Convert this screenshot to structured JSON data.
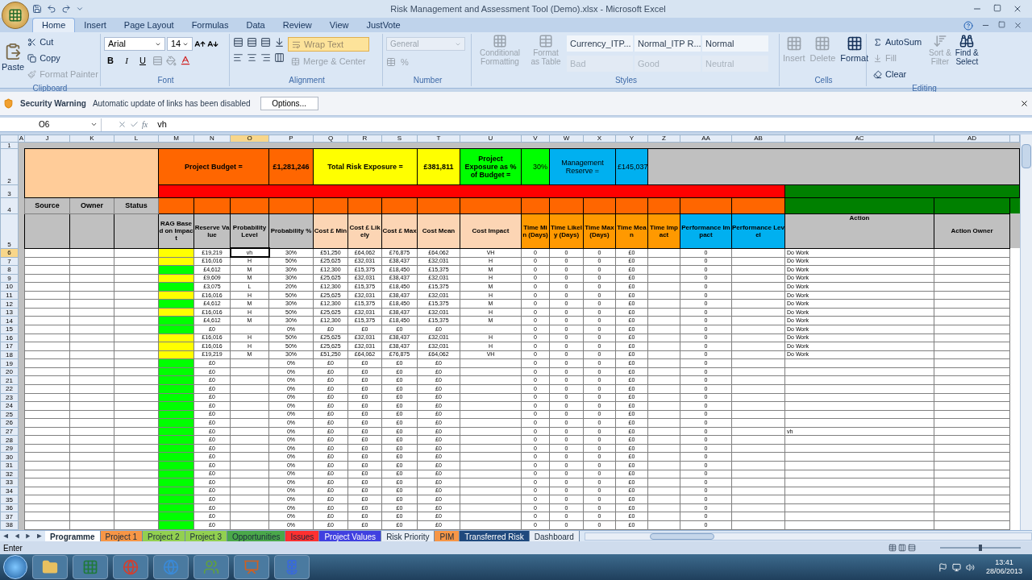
{
  "window": {
    "title": "Risk Management and Assessment Tool (Demo).xlsx - Microsoft Excel"
  },
  "ribbon_tabs": [
    {
      "label": "Home",
      "selected": true
    },
    {
      "label": "Insert",
      "selected": false
    },
    {
      "label": "Page Layout",
      "selected": false
    },
    {
      "label": "Formulas",
      "selected": false
    },
    {
      "label": "Data",
      "selected": false
    },
    {
      "label": "Review",
      "selected": false
    },
    {
      "label": "View",
      "selected": false
    },
    {
      "label": "JustVote",
      "selected": false
    }
  ],
  "ribbon": {
    "clipboard": {
      "label": "Clipboard",
      "paste": {
        "label": "Paste",
        "disabled": false
      },
      "cut": {
        "label": "Cut",
        "disabled": false
      },
      "copy": {
        "label": "Copy",
        "disabled": false
      },
      "format_painter": {
        "label": "Format Painter",
        "disabled": true
      }
    },
    "font": {
      "label": "Font",
      "family": "Arial",
      "size": "14",
      "bold": "B",
      "italic": "I",
      "underline": "U"
    },
    "alignment": {
      "label": "Alignment",
      "wrap_text": {
        "label": "Wrap Text",
        "on": true
      },
      "merge_center": {
        "label": "Merge & Center",
        "disabled": true
      }
    },
    "number": {
      "label": "Number",
      "format": "General",
      "percent": "%"
    },
    "styles": {
      "label": "Styles",
      "conditional_formatting": {
        "label": "Conditional Formatting",
        "disabled": true
      },
      "format_as_table": {
        "label": "Format as Table",
        "disabled": true
      },
      "gallery": [
        {
          "label": "Currency_ITP...",
          "disabled": false
        },
        {
          "label": "Normal_ITP R...",
          "disabled": false
        },
        {
          "label": "Normal",
          "disabled": false
        },
        {
          "label": "Bad",
          "disabled": true
        },
        {
          "label": "Good",
          "disabled": true
        },
        {
          "label": "Neutral",
          "disabled": true
        }
      ]
    },
    "cells": {
      "label": "Cells",
      "insert": {
        "label": "Insert",
        "disabled": true
      },
      "delete": {
        "label": "Delete",
        "disabled": true
      },
      "format": {
        "label": "Format",
        "disabled": false
      }
    },
    "editing": {
      "label": "Editing",
      "autosum": {
        "label": "AutoSum",
        "disabled": false
      },
      "fill": {
        "label": "Fill",
        "disabled": true
      },
      "clear": {
        "label": "Clear",
        "disabled": false
      },
      "sort_filter": {
        "label": "Sort & Filter",
        "disabled": true
      },
      "find_select": {
        "label": "Find & Select",
        "disabled": false
      }
    }
  },
  "security_bar": {
    "title": "Security Warning",
    "message": "Automatic update of links has been disabled",
    "button": "Options..."
  },
  "formula_bar": {
    "name_box": "O6",
    "fx": "fx",
    "value": "vh"
  },
  "sheet": {
    "columns": [
      {
        "label": "A",
        "selected": false
      },
      {
        "label": "J",
        "selected": false
      },
      {
        "label": "K",
        "selected": false
      },
      {
        "label": "L",
        "selected": false
      },
      {
        "label": "M",
        "selected": false
      },
      {
        "label": "N",
        "selected": false
      },
      {
        "label": "O",
        "selected": true
      },
      {
        "label": "P",
        "selected": false
      },
      {
        "label": "Q",
        "selected": false
      },
      {
        "label": "R",
        "selected": false
      },
      {
        "label": "S",
        "selected": false
      },
      {
        "label": "T",
        "selected": false
      },
      {
        "label": "U",
        "selected": false
      },
      {
        "label": "V",
        "selected": false
      },
      {
        "label": "W",
        "selected": false
      },
      {
        "label": "X",
        "selected": false
      },
      {
        "label": "Y",
        "selected": false
      },
      {
        "label": "Z",
        "selected": false
      },
      {
        "label": "AA",
        "selected": false
      },
      {
        "label": "AB",
        "selected": false
      },
      {
        "label": "AC",
        "selected": false
      },
      {
        "label": "AD",
        "selected": false
      }
    ],
    "header_rows": [
      "1",
      "2",
      "3",
      "4",
      "5"
    ],
    "banner": [
      {
        "text": "Project Budget =",
        "color": "#ff6600"
      },
      {
        "text": "£1,281,246",
        "color": "#ff6600"
      },
      {
        "text": "Total Risk Exposure =",
        "color": "#ffff00"
      },
      {
        "text": "£381,811",
        "color": "#ffff00"
      },
      {
        "text": "Project Exposure as % of Budget =",
        "color": "#00ff00"
      },
      {
        "text": "30%",
        "color": "#00ff00"
      },
      {
        "text": "Management Reserve =",
        "color": "#00b0f0"
      },
      {
        "text": "£145,037",
        "color": "#00b0f0"
      }
    ],
    "group_labels": [
      "Source",
      "Owner",
      "Status"
    ],
    "column_headers": [
      "RAG Based on Impact",
      "Reserve Value",
      "Probability Level",
      "Probability %",
      "Cost £ Min",
      "Cost £ Likely",
      "Cost £ Max",
      "Cost Mean",
      "Cost Impact",
      "Time Min (Days)",
      "Time Likely (Days)",
      "Time Max (Days)",
      "Time Mean",
      "Time Impact",
      "Performance Impact",
      "Performance Level",
      "Action",
      "Action Owner"
    ],
    "rows": [
      {
        "row": "6",
        "selected": true,
        "color": "#ffff00",
        "reserve": "£19,219",
        "prob_level": "vh",
        "prob_pct": "30%",
        "cost_min": "£51,250",
        "cost_likely": "£64,062",
        "cost_max": "£76,875",
        "cost_mean": "£64,062",
        "cost_impact": "VH",
        "time_min": "0",
        "time_likely": "0",
        "time_max": "0",
        "time_mean": "£0",
        "perf_impact": "0",
        "action": "Do Work"
      },
      {
        "row": "7",
        "selected": false,
        "color": "#ffff00",
        "reserve": "£16,016",
        "prob_level": "H",
        "prob_pct": "50%",
        "cost_min": "£25,625",
        "cost_likely": "£32,031",
        "cost_max": "£38,437",
        "cost_mean": "£32,031",
        "cost_impact": "H",
        "time_min": "0",
        "time_likely": "0",
        "time_max": "0",
        "time_mean": "£0",
        "perf_impact": "0",
        "action": "Do Work"
      },
      {
        "row": "8",
        "selected": false,
        "color": "#00ff00",
        "reserve": "£4,612",
        "prob_level": "M",
        "prob_pct": "30%",
        "cost_min": "£12,300",
        "cost_likely": "£15,375",
        "cost_max": "£18,450",
        "cost_mean": "£15,375",
        "cost_impact": "M",
        "time_min": "0",
        "time_likely": "0",
        "time_max": "0",
        "time_mean": "£0",
        "perf_impact": "0",
        "action": "Do Work"
      },
      {
        "row": "9",
        "selected": false,
        "color": "#ffff00",
        "reserve": "£9,609",
        "prob_level": "M",
        "prob_pct": "30%",
        "cost_min": "£25,625",
        "cost_likely": "£32,031",
        "cost_max": "£38,437",
        "cost_mean": "£32,031",
        "cost_impact": "H",
        "time_min": "0",
        "time_likely": "0",
        "time_max": "0",
        "time_mean": "£0",
        "perf_impact": "0",
        "action": "Do Work"
      },
      {
        "row": "10",
        "selected": false,
        "color": "#00ff00",
        "reserve": "£3,075",
        "prob_level": "L",
        "prob_pct": "20%",
        "cost_min": "£12,300",
        "cost_likely": "£15,375",
        "cost_max": "£18,450",
        "cost_mean": "£15,375",
        "cost_impact": "M",
        "time_min": "0",
        "time_likely": "0",
        "time_max": "0",
        "time_mean": "£0",
        "perf_impact": "0",
        "action": "Do Work"
      },
      {
        "row": "11",
        "selected": false,
        "color": "#ffff00",
        "reserve": "£16,016",
        "prob_level": "H",
        "prob_pct": "50%",
        "cost_min": "£25,625",
        "cost_likely": "£32,031",
        "cost_max": "£38,437",
        "cost_mean": "£32,031",
        "cost_impact": "H",
        "time_min": "0",
        "time_likely": "0",
        "time_max": "0",
        "time_mean": "£0",
        "perf_impact": "0",
        "action": "Do Work"
      },
      {
        "row": "12",
        "selected": false,
        "color": "#00ff00",
        "reserve": "£4,612",
        "prob_level": "M",
        "prob_pct": "30%",
        "cost_min": "£12,300",
        "cost_likely": "£15,375",
        "cost_max": "£18,450",
        "cost_mean": "£15,375",
        "cost_impact": "M",
        "time_min": "0",
        "time_likely": "0",
        "time_max": "0",
        "time_mean": "£0",
        "perf_impact": "0",
        "action": "Do Work"
      },
      {
        "row": "13",
        "selected": false,
        "color": "#ffff00",
        "reserve": "£16,016",
        "prob_level": "H",
        "prob_pct": "50%",
        "cost_min": "£25,625",
        "cost_likely": "£32,031",
        "cost_max": "£38,437",
        "cost_mean": "£32,031",
        "cost_impact": "H",
        "time_min": "0",
        "time_likely": "0",
        "time_max": "0",
        "time_mean": "£0",
        "perf_impact": "0",
        "action": "Do Work"
      },
      {
        "row": "14",
        "selected": false,
        "color": "#00ff00",
        "reserve": "£4,612",
        "prob_level": "M",
        "prob_pct": "30%",
        "cost_min": "£12,300",
        "cost_likely": "£15,375",
        "cost_max": "£18,450",
        "cost_mean": "£15,375",
        "cost_impact": "M",
        "time_min": "0",
        "time_likely": "0",
        "time_max": "0",
        "time_mean": "£0",
        "perf_impact": "0",
        "action": "Do Work"
      },
      {
        "row": "15",
        "selected": false,
        "color": "#00ff00",
        "reserve": "£0",
        "prob_pct": "0%",
        "cost_min": "£0",
        "cost_likely": "£0",
        "cost_max": "£0",
        "cost_mean": "£0",
        "time_min": "0",
        "time_likely": "0",
        "time_max": "0",
        "time_mean": "£0",
        "perf_impact": "0",
        "action": "Do Work"
      },
      {
        "row": "16",
        "selected": false,
        "color": "#ffff00",
        "reserve": "£16,016",
        "prob_level": "H",
        "prob_pct": "50%",
        "cost_min": "£25,625",
        "cost_likely": "£32,031",
        "cost_max": "£38,437",
        "cost_mean": "£32,031",
        "cost_impact": "H",
        "time_min": "0",
        "time_likely": "0",
        "time_max": "0",
        "time_mean": "£0",
        "perf_impact": "0",
        "action": "Do Work"
      },
      {
        "row": "17",
        "selected": false,
        "color": "#ffff00",
        "reserve": "£16,016",
        "prob_level": "H",
        "prob_pct": "50%",
        "cost_min": "£25,625",
        "cost_likely": "£32,031",
        "cost_max": "£38,437",
        "cost_mean": "£32,031",
        "cost_impact": "H",
        "time_min": "0",
        "time_likely": "0",
        "time_max": "0",
        "time_mean": "£0",
        "perf_impact": "0",
        "action": "Do Work"
      },
      {
        "row": "18",
        "selected": false,
        "color": "#ffff00",
        "reserve": "£19,219",
        "prob_level": "M",
        "prob_pct": "30%",
        "cost_min": "£51,250",
        "cost_likely": "£64,062",
        "cost_max": "£76,875",
        "cost_mean": "£64,062",
        "cost_impact": "VH",
        "time_min": "0",
        "time_likely": "0",
        "time_max": "0",
        "time_mean": "£0",
        "perf_impact": "0",
        "action": "Do Work"
      },
      {
        "row": "19",
        "selected": false,
        "color": "#00ff00",
        "reserve": "£0",
        "prob_pct": "0%",
        "cost_min": "£0",
        "cost_likely": "£0",
        "cost_max": "£0",
        "cost_mean": "£0",
        "time_min": "0",
        "time_likely": "0",
        "time_max": "0",
        "time_mean": "£0",
        "perf_impact": "0"
      },
      {
        "row": "20",
        "selected": false,
        "color": "#00ff00",
        "reserve": "£0",
        "prob_pct": "0%",
        "cost_min": "£0",
        "cost_likely": "£0",
        "cost_max": "£0",
        "cost_mean": "£0",
        "time_min": "0",
        "time_likely": "0",
        "time_max": "0",
        "time_mean": "£0",
        "perf_impact": "0"
      },
      {
        "row": "21",
        "selected": false,
        "color": "#00ff00",
        "reserve": "£0",
        "prob_pct": "0%",
        "cost_min": "£0",
        "cost_likely": "£0",
        "cost_max": "£0",
        "cost_mean": "£0",
        "time_min": "0",
        "time_likely": "0",
        "time_max": "0",
        "time_mean": "£0",
        "perf_impact": "0"
      },
      {
        "row": "22",
        "selected": false,
        "color": "#00ff00",
        "reserve": "£0",
        "prob_pct": "0%",
        "cost_min": "£0",
        "cost_likely": "£0",
        "cost_max": "£0",
        "cost_mean": "£0",
        "time_min": "0",
        "time_likely": "0",
        "time_max": "0",
        "time_mean": "£0",
        "perf_impact": "0"
      },
      {
        "row": "23",
        "selected": false,
        "color": "#00ff00",
        "reserve": "£0",
        "prob_pct": "0%",
        "cost_min": "£0",
        "cost_likely": "£0",
        "cost_max": "£0",
        "cost_mean": "£0",
        "time_min": "0",
        "time_likely": "0",
        "time_max": "0",
        "time_mean": "£0",
        "perf_impact": "0"
      },
      {
        "row": "24",
        "selected": false,
        "color": "#00ff00",
        "reserve": "£0",
        "prob_pct": "0%",
        "cost_min": "£0",
        "cost_likely": "£0",
        "cost_max": "£0",
        "cost_mean": "£0",
        "time_min": "0",
        "time_likely": "0",
        "time_max": "0",
        "time_mean": "£0",
        "perf_impact": "0"
      },
      {
        "row": "25",
        "selected": false,
        "color": "#00ff00",
        "reserve": "£0",
        "prob_pct": "0%",
        "cost_min": "£0",
        "cost_likely": "£0",
        "cost_max": "£0",
        "cost_mean": "£0",
        "time_min": "0",
        "time_likely": "0",
        "time_max": "0",
        "time_mean": "£0",
        "perf_impact": "0"
      },
      {
        "row": "26",
        "selected": false,
        "color": "#00ff00",
        "reserve": "£0",
        "prob_pct": "0%",
        "cost_min": "£0",
        "cost_likely": "£0",
        "cost_max": "£0",
        "cost_mean": "£0",
        "time_min": "0",
        "time_likely": "0",
        "time_max": "0",
        "time_mean": "£0",
        "perf_impact": "0"
      },
      {
        "row": "27",
        "selected": false,
        "color": "#00ff00",
        "reserve": "£0",
        "prob_pct": "0%",
        "cost_min": "£0",
        "cost_likely": "£0",
        "cost_max": "£0",
        "cost_mean": "£0",
        "time_min": "0",
        "time_likely": "0",
        "time_max": "0",
        "time_mean": "£0",
        "perf_impact": "0",
        "action": "vh"
      },
      {
        "row": "28",
        "selected": false,
        "color": "#00ff00",
        "reserve": "£0",
        "prob_pct": "0%",
        "cost_min": "£0",
        "cost_likely": "£0",
        "cost_max": "£0",
        "cost_mean": "£0",
        "time_min": "0",
        "time_likely": "0",
        "time_max": "0",
        "time_mean": "£0",
        "perf_impact": "0"
      },
      {
        "row": "29",
        "selected": false,
        "color": "#00ff00",
        "reserve": "£0",
        "prob_pct": "0%",
        "cost_min": "£0",
        "cost_likely": "£0",
        "cost_max": "£0",
        "cost_mean": "£0",
        "time_min": "0",
        "time_likely": "0",
        "time_max": "0",
        "time_mean": "£0",
        "perf_impact": "0"
      },
      {
        "row": "30",
        "selected": false,
        "color": "#00ff00",
        "reserve": "£0",
        "prob_pct": "0%",
        "cost_min": "£0",
        "cost_likely": "£0",
        "cost_max": "£0",
        "cost_mean": "£0",
        "time_min": "0",
        "time_likely": "0",
        "time_max": "0",
        "time_mean": "£0",
        "perf_impact": "0"
      },
      {
        "row": "31",
        "selected": false,
        "color": "#00ff00",
        "reserve": "£0",
        "prob_pct": "0%",
        "cost_min": "£0",
        "cost_likely": "£0",
        "cost_max": "£0",
        "cost_mean": "£0",
        "time_min": "0",
        "time_likely": "0",
        "time_max": "0",
        "time_mean": "£0",
        "perf_impact": "0"
      },
      {
        "row": "32",
        "selected": false,
        "color": "#00ff00",
        "reserve": "£0",
        "prob_pct": "0%",
        "cost_min": "£0",
        "cost_likely": "£0",
        "cost_max": "£0",
        "cost_mean": "£0",
        "time_min": "0",
        "time_likely": "0",
        "time_max": "0",
        "time_mean": "£0",
        "perf_impact": "0"
      },
      {
        "row": "33",
        "selected": false,
        "color": "#00ff00",
        "reserve": "£0",
        "prob_pct": "0%",
        "cost_min": "£0",
        "cost_likely": "£0",
        "cost_max": "£0",
        "cost_mean": "£0",
        "time_min": "0",
        "time_likely": "0",
        "time_max": "0",
        "time_mean": "£0",
        "perf_impact": "0"
      },
      {
        "row": "34",
        "selected": false,
        "color": "#00ff00",
        "reserve": "£0",
        "prob_pct": "0%",
        "cost_min": "£0",
        "cost_likely": "£0",
        "cost_max": "£0",
        "cost_mean": "£0",
        "time_min": "0",
        "time_likely": "0",
        "time_max": "0",
        "time_mean": "£0",
        "perf_impact": "0"
      },
      {
        "row": "35",
        "selected": false,
        "color": "#00ff00",
        "reserve": "£0",
        "prob_pct": "0%",
        "cost_min": "£0",
        "cost_likely": "£0",
        "cost_max": "£0",
        "cost_mean": "£0",
        "time_min": "0",
        "time_likely": "0",
        "time_max": "0",
        "time_mean": "£0",
        "perf_impact": "0"
      },
      {
        "row": "36",
        "selected": false,
        "color": "#00ff00",
        "reserve": "£0",
        "prob_pct": "0%",
        "cost_min": "£0",
        "cost_likely": "£0",
        "cost_max": "£0",
        "cost_mean": "£0",
        "time_min": "0",
        "time_likely": "0",
        "time_max": "0",
        "time_mean": "£0",
        "perf_impact": "0"
      },
      {
        "row": "37",
        "selected": false,
        "color": "#00ff00",
        "reserve": "£0",
        "prob_pct": "0%",
        "cost_min": "£0",
        "cost_likely": "£0",
        "cost_max": "£0",
        "cost_mean": "£0",
        "time_min": "0",
        "time_likely": "0",
        "time_max": "0",
        "time_mean": "£0",
        "perf_impact": "0"
      },
      {
        "row": "38",
        "selected": false,
        "color": "#00ff00",
        "reserve": "£0",
        "prob_pct": "0%",
        "cost_min": "£0",
        "cost_likely": "£0",
        "cost_max": "£0",
        "cost_mean": "£0",
        "time_min": "0",
        "time_likely": "0",
        "time_max": "0",
        "time_mean": "£0",
        "perf_impact": "0"
      }
    ]
  },
  "sheet_tabs": [
    {
      "label": "Programme",
      "selected": true
    },
    {
      "label": "Project 1",
      "selected": false,
      "color": "#f79646"
    },
    {
      "label": "Project 2",
      "selected": false,
      "color": "#92d050"
    },
    {
      "label": "Project 3",
      "selected": false,
      "color": "#92d050"
    },
    {
      "label": "Opportunities",
      "selected": false,
      "color": "#4aa84a"
    },
    {
      "label": "Issues",
      "selected": false,
      "color": "#ff3030"
    },
    {
      "label": "Project Values",
      "selected": false,
      "color": "#4040e0"
    },
    {
      "label": "Risk Priority",
      "selected": false
    },
    {
      "label": "PIM",
      "selected": false,
      "color": "#f79646"
    },
    {
      "label": "Transferred Risk",
      "selected": false,
      "color": "#1f497d"
    },
    {
      "label": "Dashboard",
      "selected": false
    }
  ],
  "status_bar": {
    "mode": "Enter",
    "zoom": {
      "level": 0.5
    }
  },
  "taskbar": {
    "time": "13:41",
    "date": "28/06/2013"
  }
}
